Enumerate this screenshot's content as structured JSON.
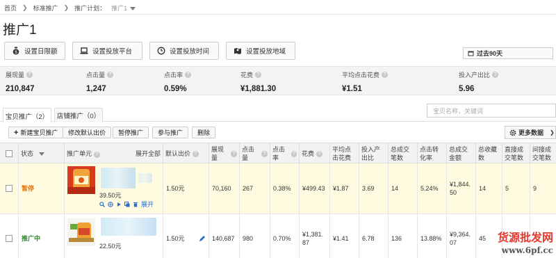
{
  "breadcrumb": {
    "home": "首页",
    "level1": "标准推广",
    "level2_prefix": "推广计划：",
    "level2_value": "推广1"
  },
  "page_title": "推广1",
  "toolbar": [
    {
      "label": "设置日限额",
      "icon": "money-bag-icon"
    },
    {
      "label": "设置投放平台",
      "icon": "laptop-icon"
    },
    {
      "label": "设置投放时间",
      "icon": "clock-icon"
    },
    {
      "label": "设置投放地域",
      "icon": "map-icon"
    }
  ],
  "period_label": "过去90天",
  "stats": [
    {
      "label": "展现量",
      "value": "210,847"
    },
    {
      "label": "点击量",
      "value": "1,247"
    },
    {
      "label": "点击率",
      "value": "0.59%"
    },
    {
      "label": "花费",
      "value": "¥1,881.30"
    },
    {
      "label": "平均点击花费",
      "value": "¥1.51"
    },
    {
      "label": "投入产出比",
      "value": "5.96"
    }
  ],
  "tabs": [
    {
      "label": "宝贝推广（2）"
    },
    {
      "label": "店铺推广（0）"
    }
  ],
  "search_placeholder": "宝贝名称，关键词",
  "actions": {
    "new": "新建宝贝推广",
    "modify_bid": "修改默认出价",
    "pause": "暂停推广",
    "join": "参与推广",
    "delete": "删除",
    "more_data": "更多数据"
  },
  "table": {
    "headers": {
      "status": "状态",
      "unit": "推广单元",
      "expand_all": "展开全部",
      "default_bid": "默认出价",
      "impressions": "展现量",
      "clicks": "点击量",
      "ctr": "点击率",
      "cost": "花费",
      "avg_cpc": "平均点击花费",
      "roi": "投入产出比",
      "total_orders": "总成交笔数",
      "conv_rate": "点击转化率",
      "total_amount": "总成交金额",
      "favorites": "总收藏数",
      "direct_orders": "直接成交笔数",
      "indirect_orders": "间接成交笔数"
    },
    "rows": [
      {
        "status": "暂停",
        "status_type": "paused",
        "price": "39.50元",
        "expand": "展开",
        "bid": "1.50元",
        "impressions": "70,160",
        "clicks": "267",
        "ctr": "0.38%",
        "cost": "¥499.43",
        "avg_cpc": "¥1.87",
        "roi": "3.69",
        "total_orders": "14",
        "conv_rate": "5.24%",
        "total_amount": "¥1,844.50",
        "favorites": "14",
        "direct_orders": "5",
        "indirect_orders": "9"
      },
      {
        "status": "推广中",
        "status_type": "running",
        "price": "22.50元",
        "expand": "",
        "bid": "1.50元",
        "impressions": "140,687",
        "clicks": "980",
        "ctr": "0.70%",
        "cost": "¥1,381.87",
        "avg_cpc": "¥1.41",
        "roi": "6.78",
        "total_orders": "136",
        "conv_rate": "13.88%",
        "total_amount": "¥9,364.07",
        "favorites": "45",
        "direct_orders": "",
        "indirect_orders": ""
      }
    ]
  },
  "watermark": {
    "line1": "货源批发网",
    "line2": "www.6pf.cc"
  },
  "colors": {
    "paused": "#e8740c",
    "running": "#2a8a2a",
    "row_highlight": "#fffbe0",
    "link": "#2a6ec8"
  }
}
